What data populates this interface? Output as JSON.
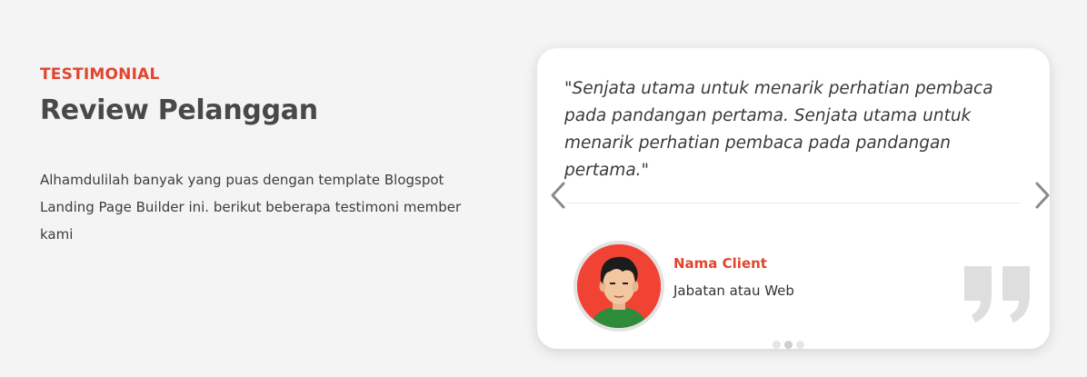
{
  "section": {
    "eyebrow": "TESTIMONIAL",
    "title": "Review Pelanggan",
    "description": "Alhamdulilah banyak yang puas dengan template Blogspot Landing Page Builder ini. berikut beberapa testimoni member kami"
  },
  "testimonial": {
    "quote": "\"Senjata utama untuk menarik perhatian pembaca pada pandangan pertama. Senjata utama untuk menarik perhatian pembaca pada pandangan pertama.\"",
    "client_name": "Nama Client",
    "client_role": "Jabatan atau Web",
    "avatar_icon": "person-avatar-icon",
    "quote_icon": "quote-mark-icon"
  },
  "carousel": {
    "prev_icon": "chevron-left-icon",
    "next_icon": "chevron-right-icon",
    "dot_count": 3,
    "active_dot": 1
  },
  "colors": {
    "accent": "#e2452f",
    "background": "#f4f4f4",
    "card": "#ffffff",
    "avatar_bg": "#f04334"
  }
}
